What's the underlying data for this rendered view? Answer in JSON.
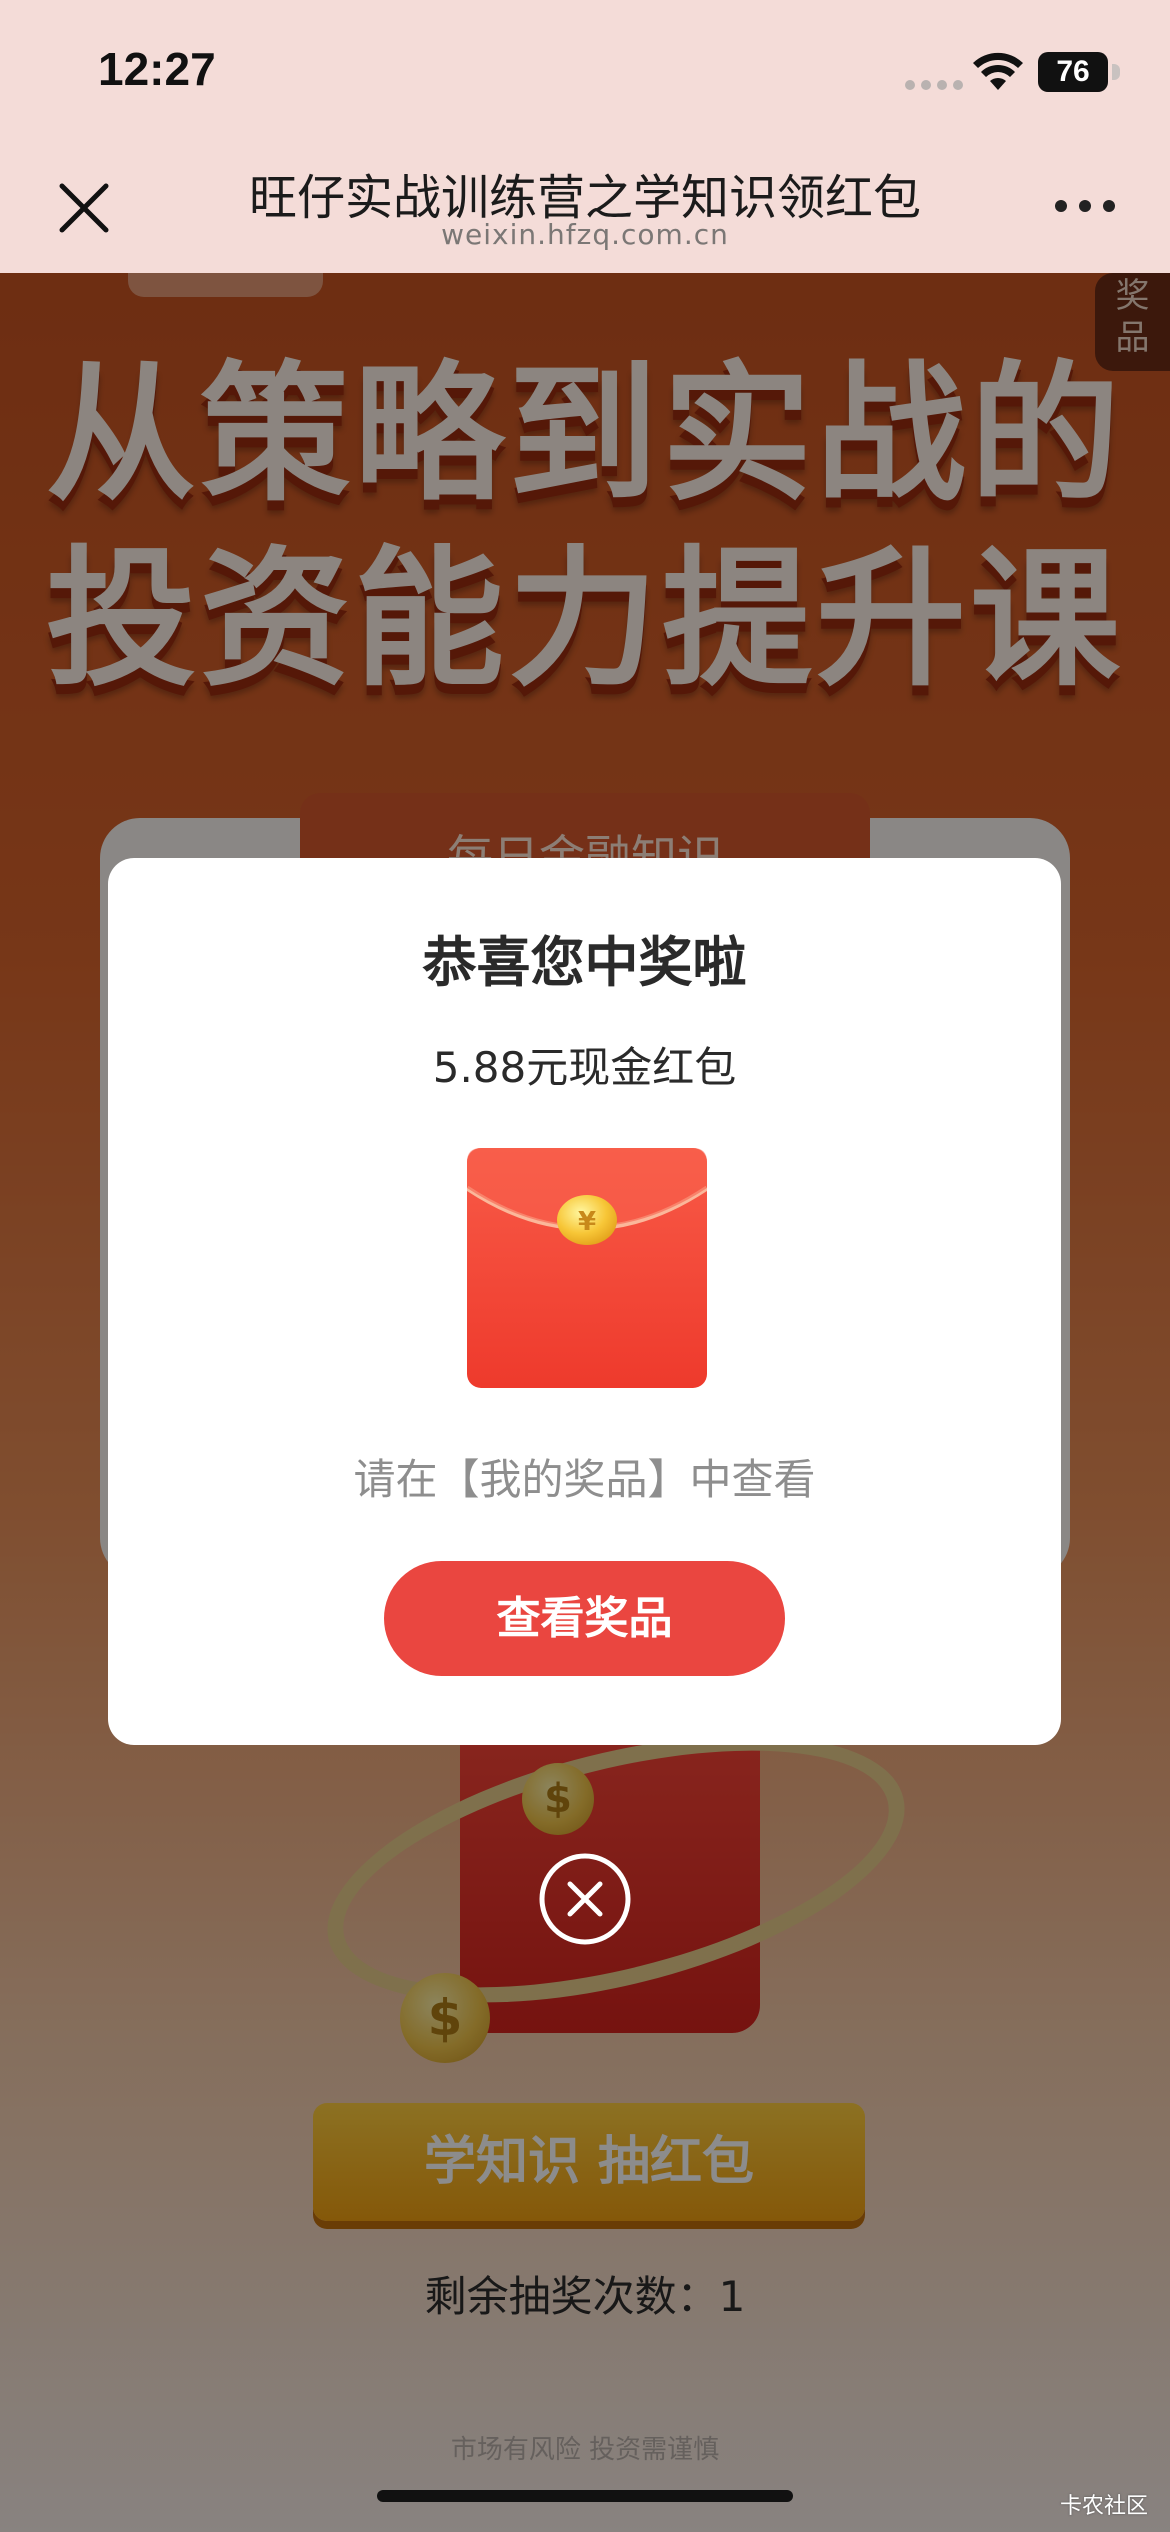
{
  "status_bar": {
    "time": "12:27",
    "battery": "76"
  },
  "nav": {
    "title": "旺仔实战训练营之学知识领红包",
    "url": "weixin.hfzq.com.cn"
  },
  "page": {
    "prize_tab": "奖\n品",
    "hero_line1": "从策略到实战的",
    "hero_line2": "投资能力提升课",
    "ribbon_text": "每日金融知识",
    "cta_label": "学知识 抽红包",
    "remaining_text": "剩余抽奖次数：1",
    "disclaimer": "市场有风险 投资需谨慎",
    "coin_symbol": "$"
  },
  "modal": {
    "title": "恭喜您中奖啦",
    "prize": "5.88元现金红包",
    "hint": "请在【我的奖品】中查看",
    "button_label": "查看奖品",
    "envelope_symbol": "¥"
  },
  "watermark": "卡农社区",
  "colors": {
    "accent_red": "#ea4640",
    "nav_bg": "#f4dcd8",
    "page_orange": "#d9642c",
    "gold": "#f2a111"
  }
}
